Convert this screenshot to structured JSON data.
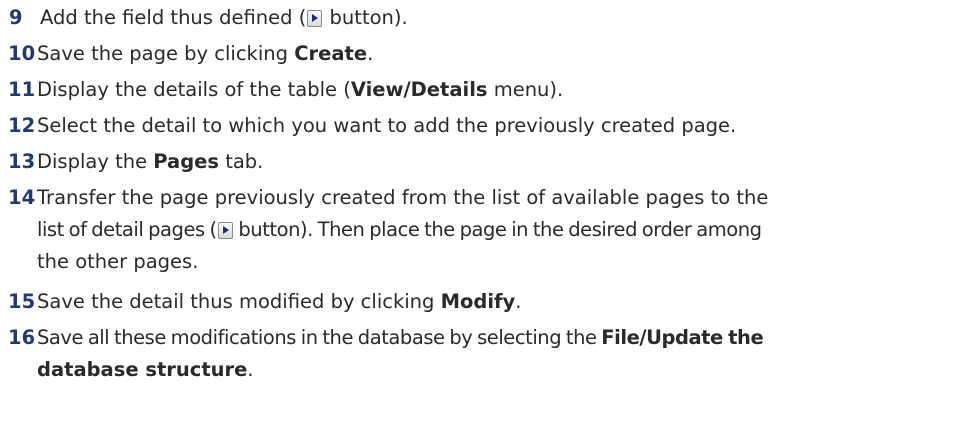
{
  "steps": [
    {
      "number": "9",
      "t1": "Add the field thus defined (",
      "icon": "right-arrow-button-icon",
      "t2": " button)."
    },
    {
      "number": "10",
      "t1": "Save the page by clicking ",
      "b1": "Create",
      "t2": "."
    },
    {
      "number": "11",
      "t1": "Display the details of the table (",
      "b1": "View/Details",
      "t2": " menu)."
    },
    {
      "number": "12",
      "t1": "Select the detail to which you want to add the previously created page."
    },
    {
      "number": "13",
      "t1": "Display the ",
      "b1": "Pages",
      "t2": " tab."
    },
    {
      "number": "14",
      "line1": "Transfer the page previously created from the list of available pages to the",
      "line2a": "list of detail pages (",
      "icon": "right-arrow-button-icon",
      "line2b": " button). Then place the page in the desired order among",
      "line3": "the other pages."
    },
    {
      "number": "15",
      "t1": "Save the detail thus modified by clicking ",
      "b1": "Modify",
      "t2": "."
    },
    {
      "number": "16",
      "t1": "Save all these modifications in the database by selecting the ",
      "b1": "File/Update the",
      "b2": "database structure",
      "t2": "."
    }
  ]
}
